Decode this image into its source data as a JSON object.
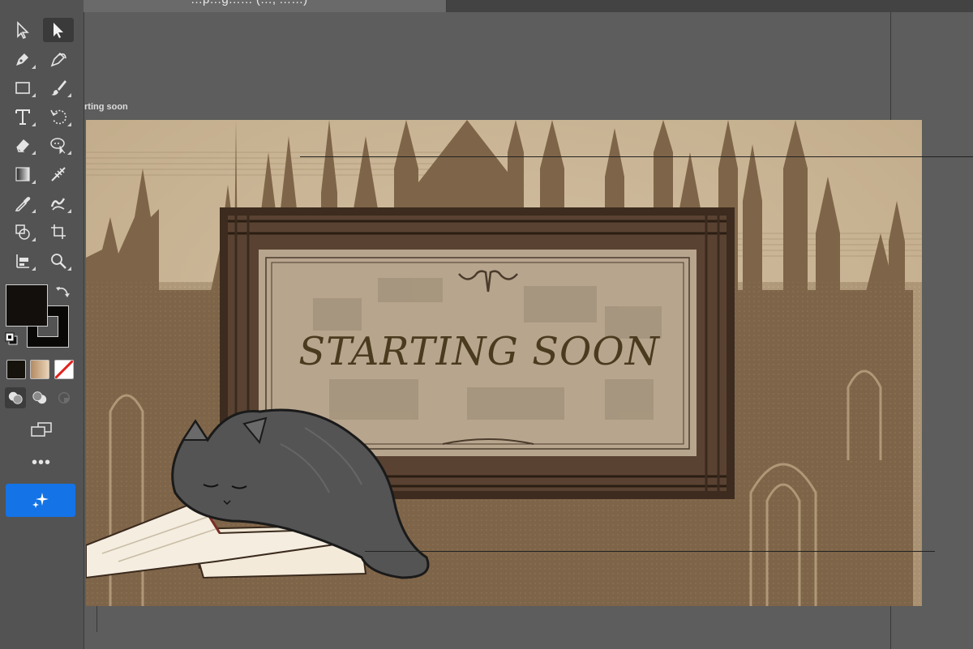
{
  "document_tab": {
    "title": "…p…g…… (…, ……)"
  },
  "artboard": {
    "label": "rting soon",
    "title_text": "STARTING SOON"
  },
  "toolbar": {
    "tools": [
      {
        "id": "direct-selection",
        "icon": "direct-selection-icon"
      },
      {
        "id": "selection",
        "icon": "selection-icon",
        "active": true
      },
      {
        "id": "pen",
        "icon": "pen-icon"
      },
      {
        "id": "curvature",
        "icon": "curvature-icon"
      },
      {
        "id": "rectangle",
        "icon": "rectangle-icon"
      },
      {
        "id": "paintbrush",
        "icon": "paintbrush-icon"
      },
      {
        "id": "type",
        "icon": "type-icon"
      },
      {
        "id": "rotate",
        "icon": "rotate-icon"
      },
      {
        "id": "eraser",
        "icon": "eraser-icon"
      },
      {
        "id": "puppet-warp",
        "icon": "puppet-warp-icon"
      },
      {
        "id": "gradient",
        "icon": "gradient-icon"
      },
      {
        "id": "mesh",
        "icon": "mesh-icon"
      },
      {
        "id": "eyedropper",
        "icon": "eyedropper-icon"
      },
      {
        "id": "blend",
        "icon": "blend-icon"
      },
      {
        "id": "shape-builder",
        "icon": "shape-builder-icon"
      },
      {
        "id": "artboard",
        "icon": "artboard-icon"
      },
      {
        "id": "graph",
        "icon": "graph-icon"
      },
      {
        "id": "zoom",
        "icon": "zoom-icon"
      }
    ],
    "fill_color": "#120f0c",
    "stroke_color": "#0a0807",
    "more_label": "•••",
    "colors": {
      "accent": "#1473e6",
      "panel": "#535353",
      "canvas": "#5d5d5d"
    }
  }
}
